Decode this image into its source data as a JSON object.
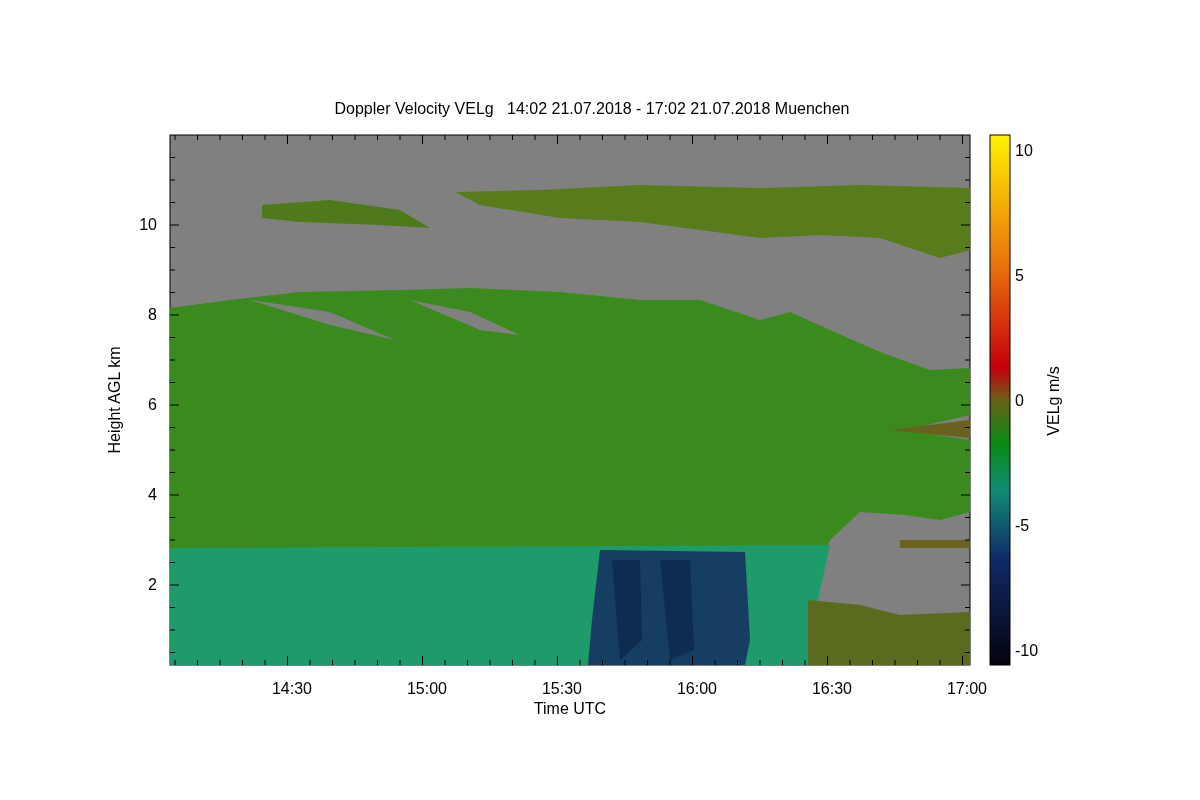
{
  "title": "Doppler Velocity VELg   14:02 21.07.2018 - 17:02 21.07.2018 Muenchen",
  "x_axis": {
    "label": "Time UTC",
    "ticks": [
      "14:30",
      "15:00",
      "15:30",
      "16:00",
      "16:30",
      "17:00"
    ]
  },
  "y_axis": {
    "label": "Height AGL km",
    "ticks": [
      "10",
      "8",
      "6",
      "4",
      "2"
    ]
  },
  "colorbar": {
    "label": "VELg m/s",
    "ticks": [
      "10",
      "5",
      "0",
      "-5",
      "-10"
    ]
  }
}
